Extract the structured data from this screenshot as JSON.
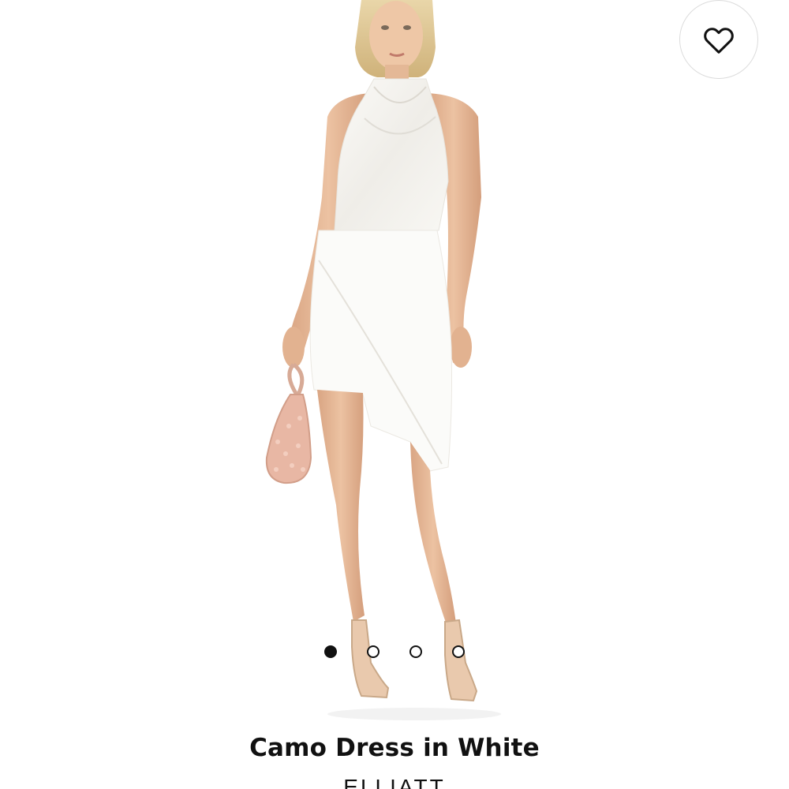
{
  "product": {
    "title": "Camo Dress in White",
    "brand": "ELLIATT"
  },
  "favorite": {
    "icon": "heart-outline-icon",
    "selected": false
  },
  "carousel": {
    "total_slides": 4,
    "active_index": 0
  },
  "colors": {
    "background": "#ffffff",
    "text": "#111111",
    "dot_active": "#111111",
    "favorite_border": "#dcdcdc"
  }
}
